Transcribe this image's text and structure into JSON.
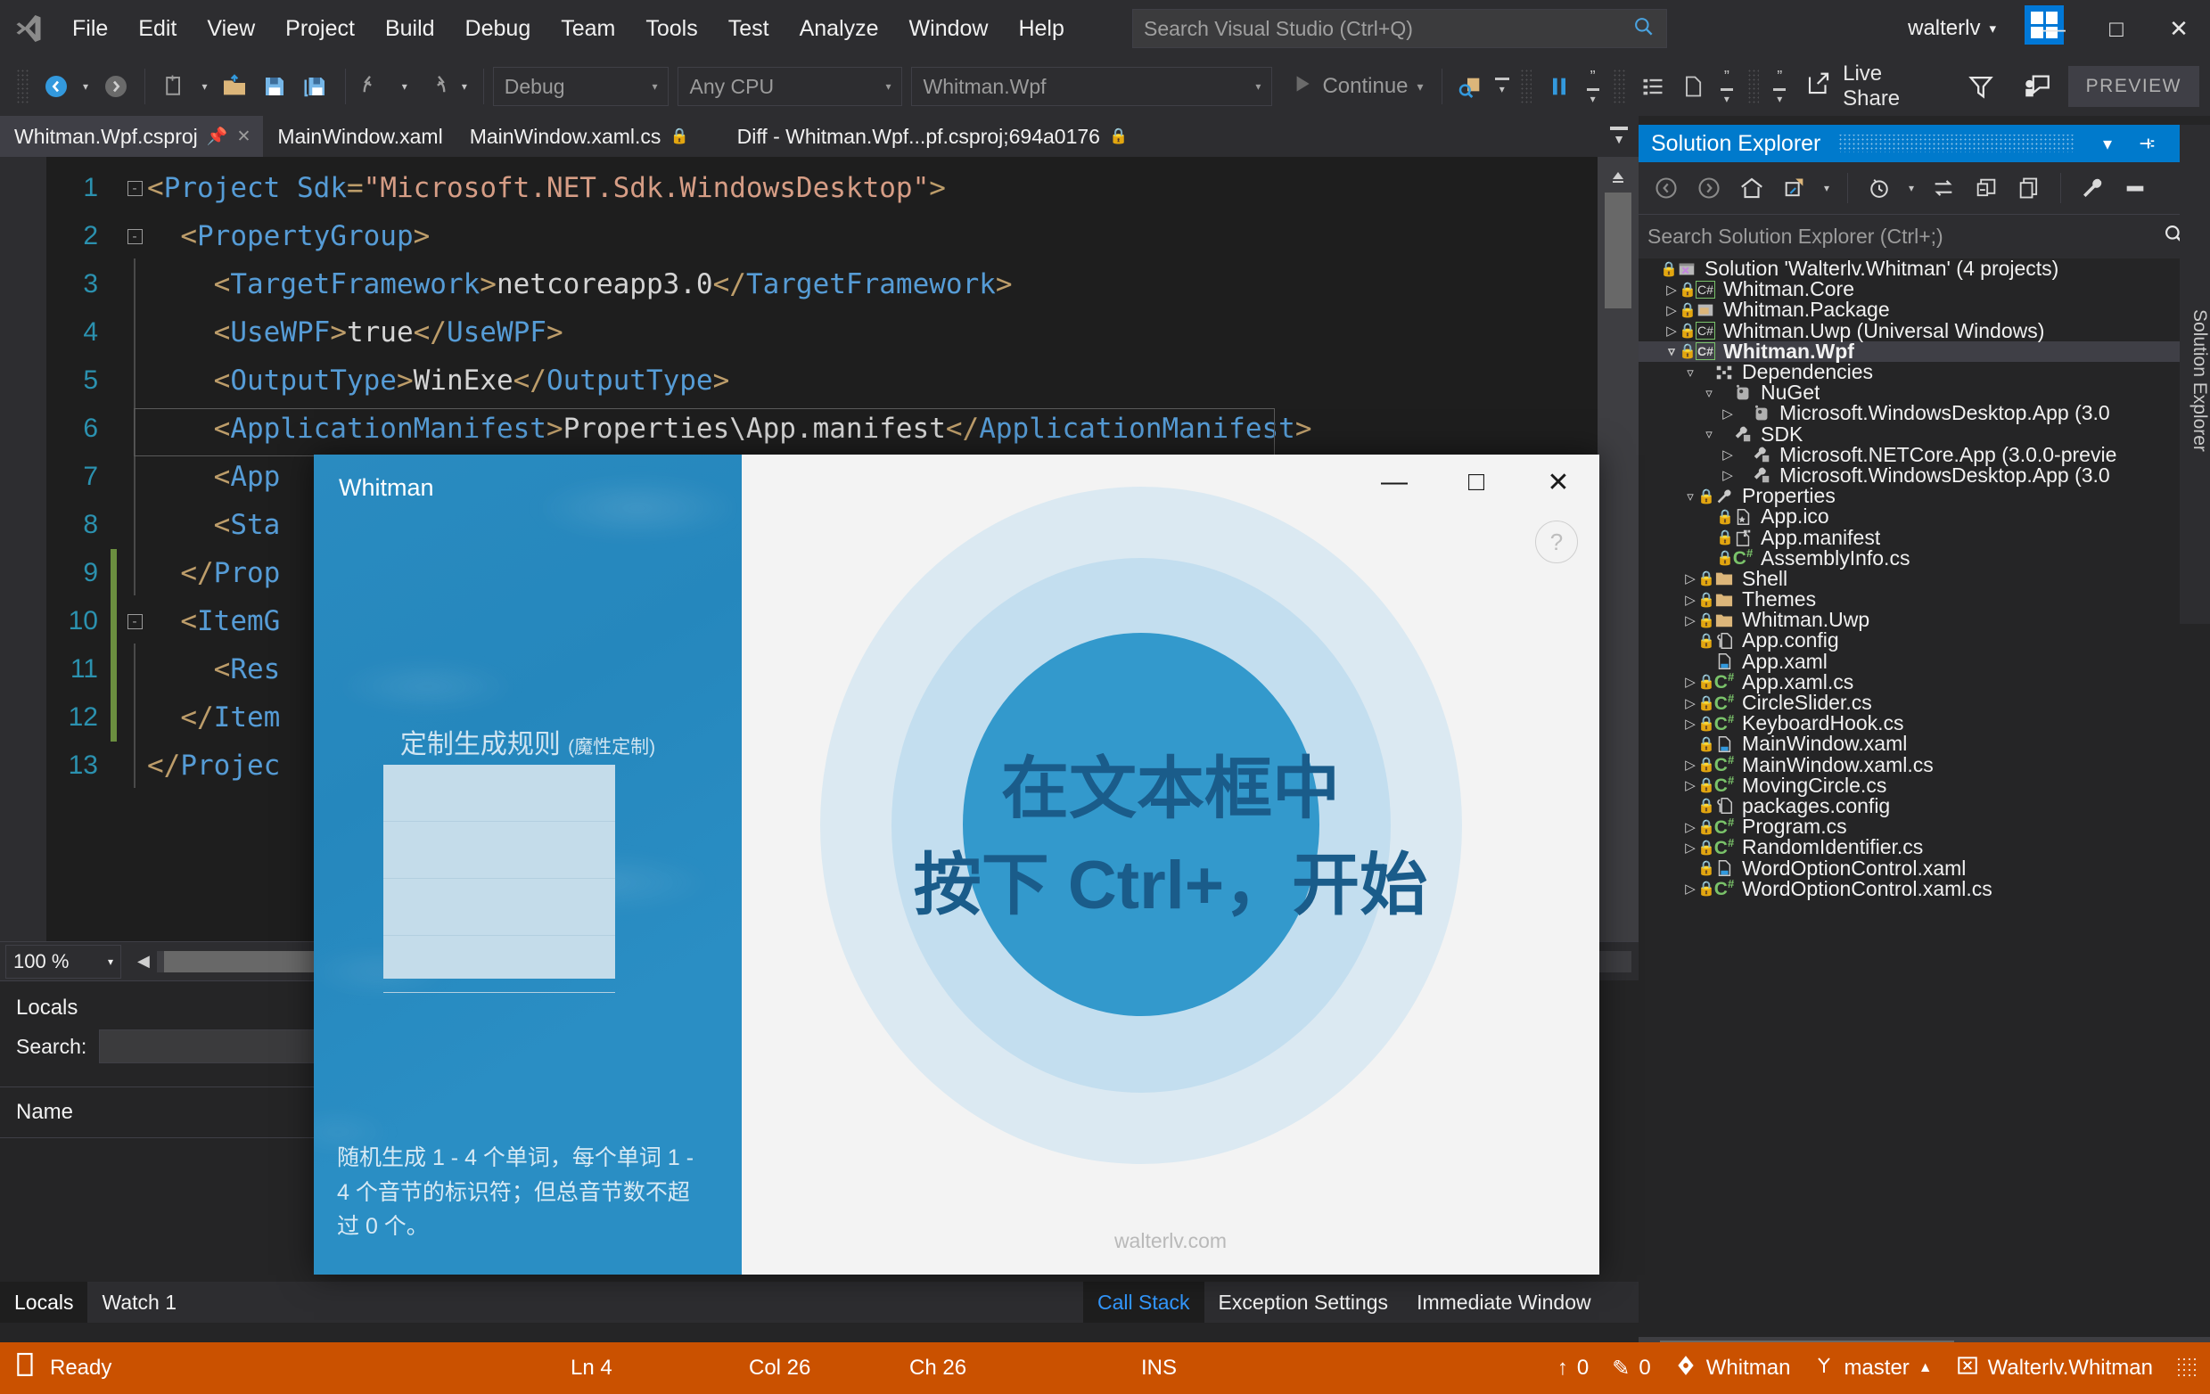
{
  "titlebar": {
    "menu": [
      "File",
      "Edit",
      "View",
      "Project",
      "Build",
      "Debug",
      "Team",
      "Tools",
      "Test",
      "Analyze",
      "Window",
      "Help"
    ],
    "search_placeholder": "Search Visual Studio (Ctrl+Q)",
    "user": "walterlv",
    "minimize": "—",
    "maximize": "□",
    "close": "✕"
  },
  "toolbar": {
    "config": "Debug",
    "platform": "Any CPU",
    "startup_project": "Whitman.Wpf",
    "run_label": "Continue",
    "live_share": "Live Share",
    "preview": "PREVIEW"
  },
  "tabs": [
    {
      "label": "Whitman.Wpf.csproj",
      "active": true,
      "pinned": true,
      "closable": true,
      "locked": false
    },
    {
      "label": "MainWindow.xaml",
      "active": false,
      "pinned": false,
      "closable": false,
      "locked": false
    },
    {
      "label": "MainWindow.xaml.cs",
      "active": false,
      "pinned": false,
      "closable": false,
      "locked": true
    },
    {
      "label": "Diff - Whitman.Wpf...pf.csproj;694a0176",
      "active": false,
      "pinned": false,
      "closable": false,
      "locked": true
    }
  ],
  "editor": {
    "zoom": "100 %",
    "lines": [
      {
        "n": 1,
        "fold": "minus",
        "changed": false,
        "html": "<span class='brk'>&lt;</span><span class='tag'>Project</span> <span class='tag'>Sdk</span><span class='brk'>=</span><span class='str'>\"Microsoft.NET.Sdk.WindowsDesktop\"</span><span class='brk'>&gt;</span>"
      },
      {
        "n": 2,
        "fold": "minus",
        "changed": false,
        "html": "  <span class='brk'>&lt;</span><span class='tag'>PropertyGroup</span><span class='brk'>&gt;</span>"
      },
      {
        "n": 3,
        "fold": "",
        "changed": false,
        "html": "    <span class='brk'>&lt;</span><span class='tag'>TargetFramework</span><span class='brk'>&gt;</span><span class='txt'>netcoreapp3.0</span><span class='brk'>&lt;/</span><span class='tag'>TargetFramework</span><span class='brk'>&gt;</span>"
      },
      {
        "n": 4,
        "fold": "",
        "changed": false,
        "html": "    <span class='brk'>&lt;</span><span class='tag'>UseWPF</span><span class='brk'>&gt;</span><span class='txt'>true</span><span class='brk'>&lt;/</span><span class='tag'>UseWPF</span><span class='brk'>&gt;</span>"
      },
      {
        "n": 5,
        "fold": "",
        "changed": false,
        "html": "    <span class='brk'>&lt;</span><span class='tag'>OutputType</span><span class='brk'>&gt;</span><span class='txt'>WinExe</span><span class='brk'>&lt;/</span><span class='tag'>OutputType</span><span class='brk'>&gt;</span>"
      },
      {
        "n": 6,
        "fold": "",
        "changed": false,
        "html": "    <span class='brk'>&lt;</span><span class='tag'>ApplicationManifest</span><span class='brk'>&gt;</span><span class='txt'>Properties\\App.manifest</span><span class='brk'>&lt;/</span><span class='tag'>ApplicationManifest</span><span class='brk'>&gt;</span>"
      },
      {
        "n": 7,
        "fold": "",
        "changed": false,
        "html": "    <span class='brk'>&lt;</span><span class='tag'>App</span>"
      },
      {
        "n": 8,
        "fold": "",
        "changed": false,
        "html": "    <span class='brk'>&lt;</span><span class='tag'>Sta</span>"
      },
      {
        "n": 9,
        "fold": "",
        "changed": true,
        "html": "  <span class='brk'>&lt;/</span><span class='tag'>Prop</span>"
      },
      {
        "n": 10,
        "fold": "minus",
        "changed": true,
        "html": "  <span class='brk'>&lt;</span><span class='tag'>ItemG</span>"
      },
      {
        "n": 11,
        "fold": "",
        "changed": true,
        "html": "    <span class='brk'>&lt;</span><span class='tag'>Res</span>"
      },
      {
        "n": 12,
        "fold": "",
        "changed": true,
        "html": "  <span class='brk'>&lt;/</span><span class='tag'>Item</span>"
      },
      {
        "n": 13,
        "fold": "",
        "changed": false,
        "html": "<span class='brk'>&lt;/</span><span class='tag'>Projec</span>"
      }
    ]
  },
  "locals": {
    "title": "Locals",
    "search_label": "Search:",
    "column_name": "Name"
  },
  "bottom_tabs_left": [
    {
      "label": "Locals",
      "active": true
    },
    {
      "label": "Watch 1",
      "active": false
    }
  ],
  "bottom_tabs_right": [
    {
      "label": "Call Stack",
      "active": true
    },
    {
      "label": "Exception Settings",
      "active": false
    },
    {
      "label": "Immediate Window",
      "active": false
    }
  ],
  "solution_explorer": {
    "title": "Solution Explorer",
    "search_placeholder": "Search Solution Explorer (Ctrl+;)",
    "vertical_tab": "Solution Explorer",
    "tree": [
      {
        "indent": 0,
        "arrow": "",
        "lock": true,
        "icon": "solution",
        "label": "Solution 'Walterlv.Whitman' (4 projects)",
        "selected": false,
        "bold": false
      },
      {
        "indent": 1,
        "arrow": "right",
        "lock": true,
        "icon": "csproj",
        "label": "Whitman.Core",
        "selected": false,
        "bold": false
      },
      {
        "indent": 1,
        "arrow": "right",
        "lock": true,
        "icon": "package",
        "label": "Whitman.Package",
        "selected": false,
        "bold": false
      },
      {
        "indent": 1,
        "arrow": "right",
        "lock": true,
        "icon": "csproj",
        "label": "Whitman.Uwp (Universal Windows)",
        "selected": false,
        "bold": false
      },
      {
        "indent": 1,
        "arrow": "down",
        "lock": true,
        "icon": "csproj",
        "label": "Whitman.Wpf",
        "selected": true,
        "bold": true
      },
      {
        "indent": 2,
        "arrow": "down",
        "lock": false,
        "icon": "deps",
        "label": "Dependencies",
        "selected": false,
        "bold": false
      },
      {
        "indent": 3,
        "arrow": "down",
        "lock": false,
        "icon": "nuget",
        "label": "NuGet",
        "selected": false,
        "bold": false
      },
      {
        "indent": 4,
        "arrow": "right",
        "lock": false,
        "icon": "nuget",
        "label": "Microsoft.WindowsDesktop.App (3.0",
        "selected": false,
        "bold": false
      },
      {
        "indent": 3,
        "arrow": "down",
        "lock": false,
        "icon": "sdk",
        "label": "SDK",
        "selected": false,
        "bold": false
      },
      {
        "indent": 4,
        "arrow": "right",
        "lock": false,
        "icon": "sdk",
        "label": "Microsoft.NETCore.App (3.0.0-previe",
        "selected": false,
        "bold": false
      },
      {
        "indent": 4,
        "arrow": "right",
        "lock": false,
        "icon": "sdk",
        "label": "Microsoft.WindowsDesktop.App (3.0",
        "selected": false,
        "bold": false
      },
      {
        "indent": 2,
        "arrow": "down",
        "lock": true,
        "icon": "wrench",
        "label": "Properties",
        "selected": false,
        "bold": false
      },
      {
        "indent": 3,
        "arrow": "",
        "lock": true,
        "icon": "ico",
        "label": "App.ico",
        "selected": false,
        "bold": false
      },
      {
        "indent": 3,
        "arrow": "",
        "lock": true,
        "icon": "manifest",
        "label": "App.manifest",
        "selected": false,
        "bold": false
      },
      {
        "indent": 3,
        "arrow": "",
        "lock": true,
        "icon": "cs",
        "label": "AssemblyInfo.cs",
        "selected": false,
        "bold": false
      },
      {
        "indent": 2,
        "arrow": "right",
        "lock": true,
        "icon": "folder",
        "label": "Shell",
        "selected": false,
        "bold": false
      },
      {
        "indent": 2,
        "arrow": "right",
        "lock": true,
        "icon": "folder",
        "label": "Themes",
        "selected": false,
        "bold": false
      },
      {
        "indent": 2,
        "arrow": "right",
        "lock": true,
        "icon": "folder",
        "label": "Whitman.Uwp",
        "selected": false,
        "bold": false
      },
      {
        "indent": 2,
        "arrow": "",
        "lock": true,
        "icon": "config",
        "label": "App.config",
        "selected": false,
        "bold": false
      },
      {
        "indent": 2,
        "arrow": "",
        "lock": false,
        "icon": "xaml",
        "label": "App.xaml",
        "selected": false,
        "bold": false
      },
      {
        "indent": 2,
        "arrow": "right",
        "lock": true,
        "icon": "cs",
        "label": "App.xaml.cs",
        "selected": false,
        "bold": false
      },
      {
        "indent": 2,
        "arrow": "right",
        "lock": true,
        "icon": "cs",
        "label": "CircleSlider.cs",
        "selected": false,
        "bold": false
      },
      {
        "indent": 2,
        "arrow": "right",
        "lock": true,
        "icon": "cs",
        "label": "KeyboardHook.cs",
        "selected": false,
        "bold": false
      },
      {
        "indent": 2,
        "arrow": "",
        "lock": true,
        "icon": "xaml",
        "label": "MainWindow.xaml",
        "selected": false,
        "bold": false
      },
      {
        "indent": 2,
        "arrow": "right",
        "lock": true,
        "icon": "cs",
        "label": "MainWindow.xaml.cs",
        "selected": false,
        "bold": false
      },
      {
        "indent": 2,
        "arrow": "right",
        "lock": true,
        "icon": "cs",
        "label": "MovingCircle.cs",
        "selected": false,
        "bold": false
      },
      {
        "indent": 2,
        "arrow": "",
        "lock": true,
        "icon": "config",
        "label": "packages.config",
        "selected": false,
        "bold": false
      },
      {
        "indent": 2,
        "arrow": "right",
        "lock": true,
        "icon": "cs",
        "label": "Program.cs",
        "selected": false,
        "bold": false
      },
      {
        "indent": 2,
        "arrow": "right",
        "lock": true,
        "icon": "cs",
        "label": "RandomIdentifier.cs",
        "selected": false,
        "bold": false
      },
      {
        "indent": 2,
        "arrow": "",
        "lock": true,
        "icon": "xaml",
        "label": "WordOptionControl.xaml",
        "selected": false,
        "bold": false
      },
      {
        "indent": 2,
        "arrow": "right",
        "lock": true,
        "icon": "cs",
        "label": "WordOptionControl.xaml.cs",
        "selected": false,
        "bold": false
      }
    ]
  },
  "wpf_window": {
    "app_name": "Whitman",
    "minimize": "—",
    "maximize": "□",
    "close": "✕",
    "help": "?",
    "rule_title": "定制生成规则",
    "rule_subtitle": "(魔性定制)",
    "description": "随机生成 1 - 4 个单词，每个单词 1 - 4 个音节的标识符；但总音节数不超过 0 个。",
    "big_line_1": "在文本框中",
    "big_line_2": "按下 Ctrl+，开始",
    "watermark": "walterlv.com"
  },
  "statusbar": {
    "state": "Ready",
    "line": "Ln 4",
    "col": "Col 26",
    "ch": "Ch 26",
    "ins": "INS",
    "publish_count": "0",
    "edit_count": "0",
    "repo": "Whitman",
    "branch": "master",
    "solution": "Walterlv.Whitman"
  },
  "colors": {
    "accent": "#007acc",
    "status": "#ca5100",
    "chrome": "#2d2d30",
    "editor_bg": "#1e1e1e",
    "wpf_blue": "#2a8ec4"
  }
}
